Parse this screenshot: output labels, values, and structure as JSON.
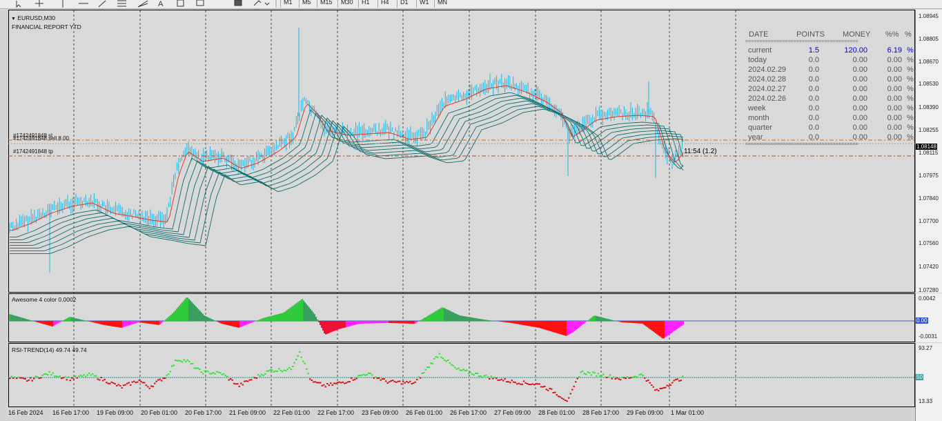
{
  "toolbar": {
    "timeframes": [
      "M1",
      "M5",
      "M15",
      "M30",
      "H1",
      "H4",
      "D1",
      "W1",
      "MN"
    ],
    "tools": [
      "cursor-icon",
      "crosshair-icon",
      "vertical-line-icon",
      "horizontal-line-icon",
      "trendline-icon",
      "fibonacci-icon",
      "fibo-fan-icon",
      "text-icon",
      "label-icon",
      "rectangle-icon",
      "shapes-icon",
      "arrows-icon"
    ],
    "text_tool": "A"
  },
  "chart": {
    "symbol": "EURUSD,M30",
    "subtitle": "FINANCIAL REPORT YTD",
    "order_labels": [
      "#1742491848 sl",
      "#1742491848 sell 8.00",
      "#1742491848 tp"
    ],
    "timer": "11:54 (1.2)",
    "price_labels": [
      "1.08945",
      "1.08805",
      "1.08670",
      "1.08530",
      "1.08390",
      "1.08255",
      "1.08115",
      "1.07975",
      "1.07840",
      "1.07700",
      "1.07560",
      "1.07420",
      "1.07280"
    ],
    "current_price": "1.08148",
    "colors": {
      "candles": "#19b6e6",
      "fast_ma": "#e8341c",
      "slow_ma": "#0a6b6b",
      "order_line": "#e0620f",
      "tp_line": "#c0462a"
    }
  },
  "awesome": {
    "title": "Awesome 4 color 0.0002",
    "scale_top": "0.0042",
    "scale_zero": "0.00",
    "scale_bottom": "-0.0031"
  },
  "rsi": {
    "title": "RSI-TREND(14) 49.74 49.74",
    "scale_top": "93.27",
    "scale_mid": "50",
    "scale_bottom": "13.33"
  },
  "time_axis": [
    "16 Feb 2024",
    "16 Feb 17:00",
    "19 Feb 09:00",
    "20 Feb 01:00",
    "20 Feb 17:00",
    "21 Feb 09:00",
    "22 Feb 01:00",
    "22 Feb 17:00",
    "23 Feb 09:00",
    "26 Feb 01:00",
    "26 Feb 17:00",
    "27 Feb 09:00",
    "28 Feb 01:00",
    "28 Feb 17:00",
    "29 Feb 09:00",
    "1 Mar 01:00"
  ],
  "report": {
    "headers": [
      "DATE",
      "POINTS",
      "MONEY",
      "%%",
      "%"
    ],
    "separator": "========================================",
    "rows": [
      {
        "date": "current",
        "points": "1.5",
        "money": "120.00",
        "pct": "6.19",
        "sign": "%"
      },
      {
        "date": "today",
        "points": "0.0",
        "money": "0.00",
        "pct": "0.00",
        "sign": "%"
      },
      {
        "date": "2024.02.29",
        "points": "0.0",
        "money": "0.00",
        "pct": "0.00",
        "sign": "%"
      },
      {
        "date": "2024.02.28",
        "points": "0.0",
        "money": "0.00",
        "pct": "0.00",
        "sign": "%"
      },
      {
        "date": "2024.02.27",
        "points": "0.0",
        "money": "0.00",
        "pct": "0.00",
        "sign": "%"
      },
      {
        "date": "2024.02.26",
        "points": "0.0",
        "money": "0.00",
        "pct": "0.00",
        "sign": "%"
      },
      {
        "date": "week",
        "points": "0.0",
        "money": "0.00",
        "pct": "0.00",
        "sign": "%"
      },
      {
        "date": "month",
        "points": "0.0",
        "money": "0.00",
        "pct": "0.00",
        "sign": "%"
      },
      {
        "date": "quarter",
        "points": "0.0",
        "money": "0.00",
        "pct": "0.00",
        "sign": "%"
      },
      {
        "date": "year",
        "points": "0.0",
        "money": "0.00",
        "pct": "0.00",
        "sign": "%"
      }
    ]
  }
}
